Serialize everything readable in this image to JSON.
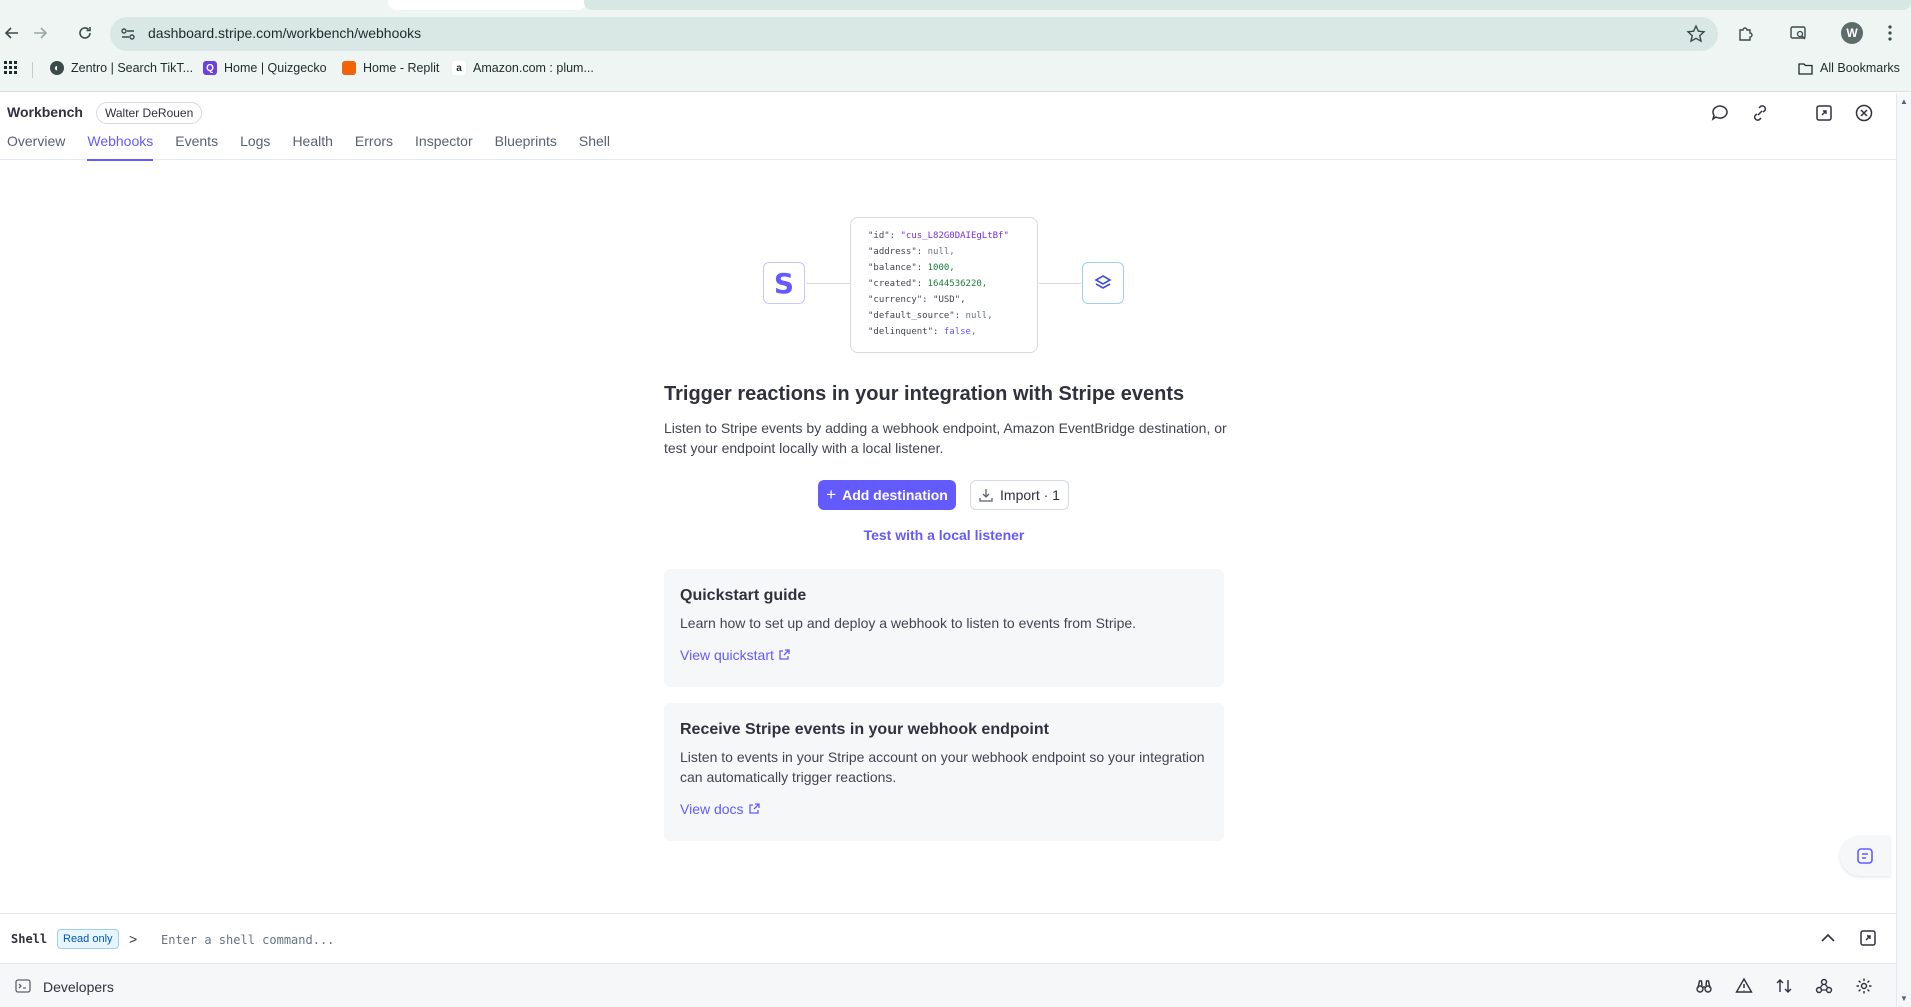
{
  "browser": {
    "url": "dashboard.stripe.com/workbench/webhooks",
    "profile_initial": "W",
    "bookmarks": [
      {
        "label": "Zentro | Search TikT...",
        "icon": "globe-icon",
        "color": "#3b4a4a"
      },
      {
        "label": "Home | Quizgecko",
        "icon": "quizgecko-icon",
        "color": "#6c3fe3"
      },
      {
        "label": "Home - Replit",
        "icon": "replit-icon",
        "color": "#f26207"
      },
      {
        "label": "Amazon.com : plum...",
        "icon": "amazon-icon",
        "color": "#1f2b2b"
      }
    ],
    "all_bookmarks_label": "All Bookmarks"
  },
  "workbench": {
    "title": "Workbench",
    "account": "Walter DeRouen",
    "tabs": [
      {
        "label": "Overview",
        "active": false
      },
      {
        "label": "Webhooks",
        "active": true
      },
      {
        "label": "Events",
        "active": false
      },
      {
        "label": "Logs",
        "active": false
      },
      {
        "label": "Health",
        "active": false
      },
      {
        "label": "Errors",
        "active": false
      },
      {
        "label": "Inspector",
        "active": false
      },
      {
        "label": "Blueprints",
        "active": false
      },
      {
        "label": "Shell",
        "active": false
      }
    ]
  },
  "illustration": {
    "logo_letter": "S",
    "code": [
      {
        "key": "\"id\":",
        "value": "\"cus_L82G0DAIEgLtBf\"",
        "type": "str"
      },
      {
        "key": "\"address\":",
        "value": "null,",
        "type": "nul"
      },
      {
        "key": "\"balance\":",
        "value": "1000,",
        "type": "num"
      },
      {
        "key": "\"created\":",
        "value": "1644536220,",
        "type": "num"
      },
      {
        "key": "\"currency\":",
        "value": "\"USD\",",
        "type": "k"
      },
      {
        "key": "\"default_source\":",
        "value": "null,",
        "type": "nul"
      },
      {
        "key": "\"delinquent\":",
        "value": "false,",
        "type": "bool"
      }
    ]
  },
  "hero": {
    "headline": "Trigger reactions in your integration with Stripe events",
    "description": "Listen to Stripe events by adding a webhook endpoint, Amazon EventBridge destination, or test your endpoint locally with a local listener.",
    "add_destination": "Add destination",
    "import": "Import · 1",
    "test_local": "Test with a local listener"
  },
  "cards": [
    {
      "title": "Quickstart guide",
      "body": "Learn how to set up and deploy a webhook to listen to events from Stripe.",
      "link": "View quickstart"
    },
    {
      "title": "Receive Stripe events in your webhook endpoint",
      "body": "Listen to events in your Stripe account on your webhook endpoint so your integration can automatically trigger reactions.",
      "link": "View docs"
    }
  ],
  "shell": {
    "label": "Shell",
    "badge": "Read only",
    "prompt": ">",
    "placeholder": "Enter a shell command..."
  },
  "developers": {
    "label": "Developers"
  },
  "colors": {
    "accent": "#635bff",
    "browser_chrome": "#eef5f3"
  }
}
